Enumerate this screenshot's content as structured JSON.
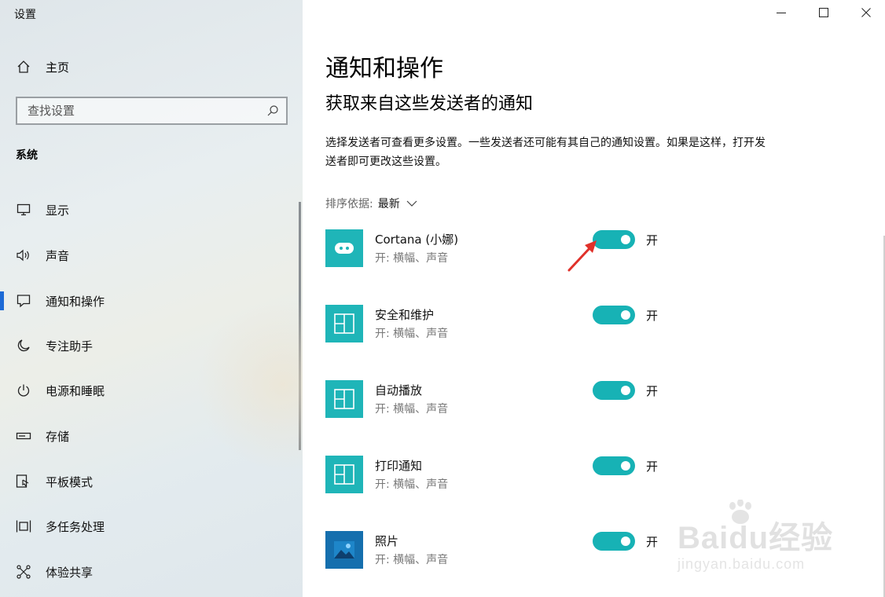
{
  "window": {
    "title": "设置"
  },
  "sidebar": {
    "home_label": "主页",
    "search_placeholder": "查找设置",
    "section_label": "系统",
    "items": [
      {
        "label": "显示",
        "icon": "monitor-icon"
      },
      {
        "label": "声音",
        "icon": "speaker-icon"
      },
      {
        "label": "通知和操作",
        "icon": "notification-icon",
        "active": true
      },
      {
        "label": "专注助手",
        "icon": "moon-icon"
      },
      {
        "label": "电源和睡眠",
        "icon": "power-icon"
      },
      {
        "label": "存储",
        "icon": "storage-icon"
      },
      {
        "label": "平板模式",
        "icon": "tablet-mode-icon"
      },
      {
        "label": "多任务处理",
        "icon": "multitasking-icon"
      },
      {
        "label": "体验共享",
        "icon": "share-icon"
      }
    ]
  },
  "main": {
    "title": "通知和操作",
    "subtitle": "获取来自这些发送者的通知",
    "description": "选择发送者可查看更多设置。一些发送者还可能有其自己的通知设置。如果是这样，打开发送者即可更改这些设置。",
    "sort": {
      "label": "排序依据:",
      "value": "最新"
    },
    "senders": [
      {
        "name": "Cortana (小娜)",
        "status": "开: 横幅、声音",
        "toggle_label": "开",
        "on": true,
        "icon": "cortana-icon"
      },
      {
        "name": "安全和维护",
        "status": "开: 横幅、声音",
        "toggle_label": "开",
        "on": true,
        "icon": "app-tile-icon"
      },
      {
        "name": "自动播放",
        "status": "开: 横幅、声音",
        "toggle_label": "开",
        "on": true,
        "icon": "app-tile-icon"
      },
      {
        "name": "打印通知",
        "status": "开: 横幅、声音",
        "toggle_label": "开",
        "on": true,
        "icon": "app-tile-icon"
      },
      {
        "name": "照片",
        "status": "开: 横幅、声音",
        "toggle_label": "开",
        "on": true,
        "icon": "photos-icon"
      }
    ]
  },
  "watermark": {
    "brand": "Baidu经验",
    "url": "jingyan.baidu.com"
  },
  "colors": {
    "accent": "#17b2b5",
    "nav_accent": "#1d6ad6",
    "arrow": "#e0312a"
  }
}
